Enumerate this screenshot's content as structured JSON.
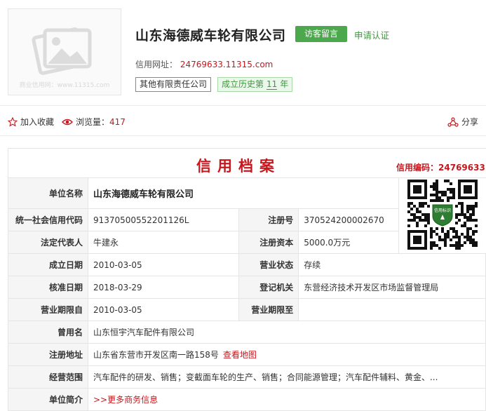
{
  "header": {
    "logo_watermark": "商业信用网：www.11315.com",
    "company_name": "山东海德威车轮有限公司",
    "visit_button": "访客留言",
    "apply_link": "申请认证",
    "url_label": "信用网址：",
    "url_value": "24769633.11315.com",
    "tag_type": "其他有限责任公司",
    "history_prefix": "成立历史第",
    "history_years": "11",
    "history_suffix": "年"
  },
  "actions": {
    "favorite_label": "加入收藏",
    "views_label": "浏览量：",
    "views_count": "417",
    "share_label": "分享"
  },
  "credit": {
    "title": "信用档案",
    "code_label": "信用编码：",
    "code_value": "24769633",
    "qr_caption": "信用标识",
    "rows": {
      "name_label": "单位名称",
      "name_value": "山东海德威车轮有限公司",
      "uscc_label": "统一社会信用代码",
      "uscc_value": "91370500552201126L",
      "regno_label": "注册号",
      "regno_value": "370524200002670",
      "legal_label": "法定代表人",
      "legal_value": "牛建永",
      "capital_label": "注册资本",
      "capital_value": "5000.0万元",
      "founded_label": "成立日期",
      "founded_value": "2010-03-05",
      "status_label": "营业状态",
      "status_value": "存续",
      "approved_label": "核准日期",
      "approved_value": "2018-03-29",
      "authority_label": "登记机关",
      "authority_value": "东营经济技术开发区市场监督管理局",
      "term_from_label": "营业期限自",
      "term_from_value": "2010-03-05",
      "term_to_label": "营业期限至",
      "term_to_value": "",
      "former_label": "曾用名",
      "former_value": "山东恒宇汽车配件有限公司",
      "address_label": "注册地址",
      "address_value": "山东省东营市开发区南一路158号",
      "map_link": "查看地图",
      "scope_label": "经营范围",
      "scope_value": "汽车配件的研发、销售；变截面车轮的生产、销售；合同能源管理；汽车配件辅料、黄金、...",
      "intro_label": "单位简介",
      "intro_link": ">>更多商务信息"
    }
  },
  "colors": {
    "brand_red": "#c8161d",
    "green_button": "#4ca84c",
    "green_text": "#3c9a3c"
  },
  "icons": [
    "image-placeholder-icon",
    "star-icon",
    "eye-icon",
    "share-icon",
    "qr-code-icon"
  ]
}
